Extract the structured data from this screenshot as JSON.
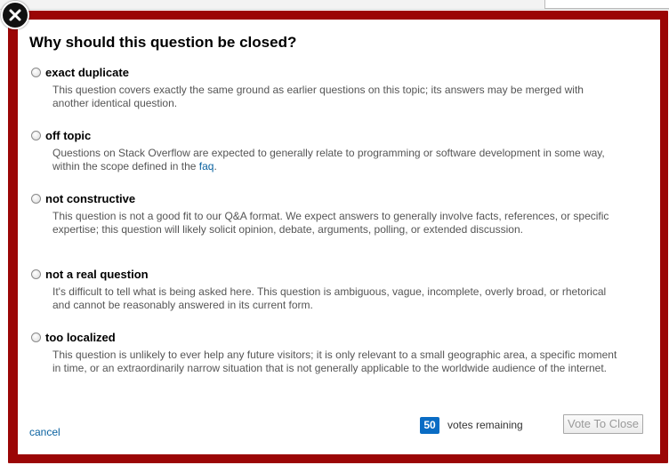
{
  "modal": {
    "title": "Why should this question be closed?",
    "reasons": [
      {
        "label": "exact duplicate",
        "description": "This question covers exactly the same ground as earlier questions on this topic; its answers may be merged with another identical question."
      },
      {
        "label": "off topic",
        "description_before_link": "Questions on Stack Overflow are expected to generally relate to programming or software development in some way, within the scope defined in the ",
        "link_text": "faq",
        "description_after_link": "."
      },
      {
        "label": "not constructive",
        "description": "This question is not a good fit to our Q&A format. We expect answers to generally involve facts, references, or specific expertise; this question will likely solicit opinion, debate, arguments, polling, or extended discussion."
      },
      {
        "label": "not a real question",
        "description": "It's difficult to tell what is being asked here. This question is ambiguous, vague, incomplete, overly broad, or rhetorical and cannot be reasonably answered in its current form."
      },
      {
        "label": "too localized",
        "description": "This question is unlikely to ever help any future visitors; it is only relevant to a small geographic area, a specific moment in time, or an extraordinarily narrow situation that is not generally applicable to the worldwide audience of the internet."
      }
    ],
    "cancel_label": "cancel",
    "votes_count": "50",
    "votes_label": "votes remaining",
    "vote_button_label": "Vote To Close"
  },
  "icons": {
    "close": "close-icon",
    "radio": "radio-button"
  },
  "colors": {
    "frame": "#9b0606",
    "link": "#0a62a0",
    "votes_badge": "#0a6cc4",
    "description_text": "#555555"
  }
}
